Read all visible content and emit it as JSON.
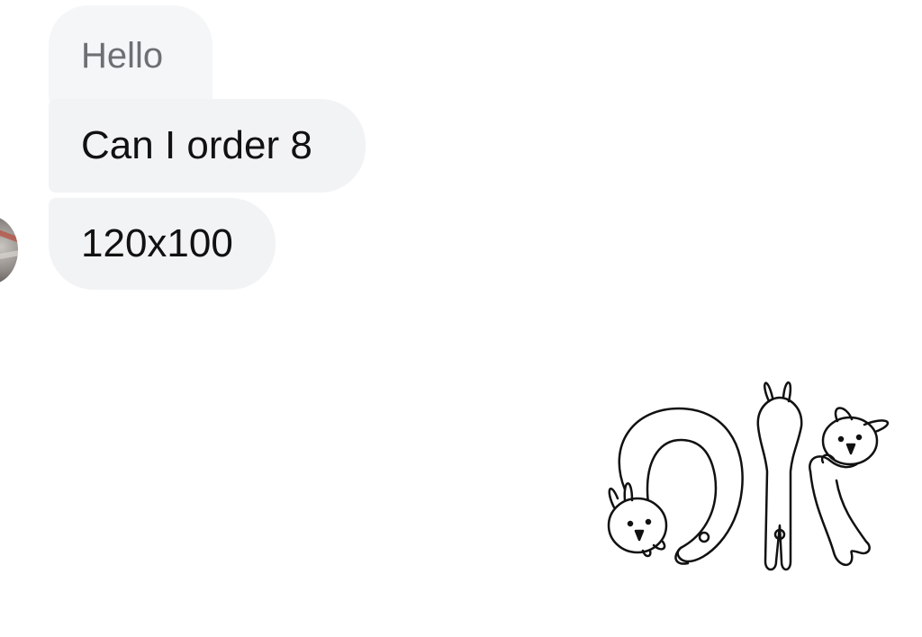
{
  "messages": [
    {
      "text": "Hello"
    },
    {
      "text": "Can I order 8"
    },
    {
      "text": "120x100"
    }
  ],
  "sticker": {
    "name": "ok-rabbits-sticker"
  }
}
